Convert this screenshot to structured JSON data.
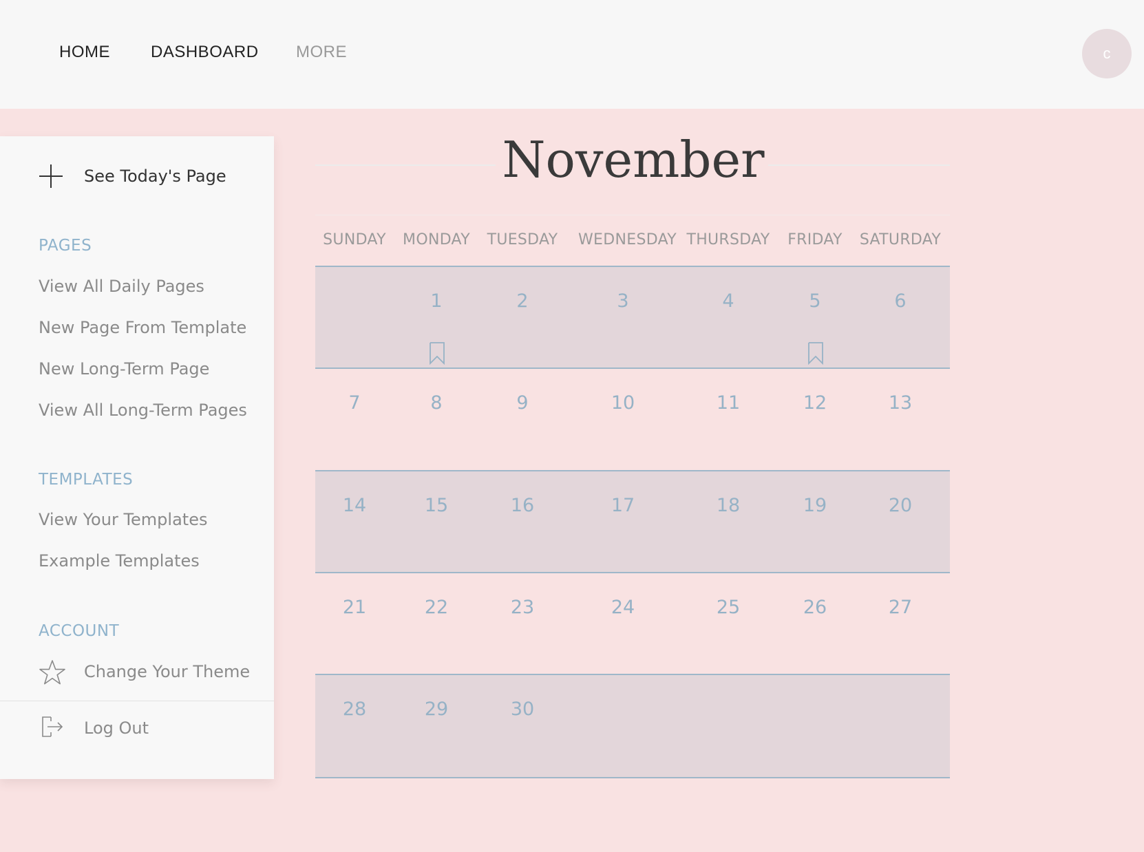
{
  "nav": {
    "home": "HOME",
    "dashboard": "DASHBOARD",
    "more": "MORE",
    "avatar_initial": "c"
  },
  "sidebar": {
    "today": "See Today's Page",
    "pages_heading": "PAGES",
    "pages": [
      "View All Daily Pages",
      "New Page From Template",
      "New Long-Term Page",
      "View All Long-Term Pages"
    ],
    "templates_heading": "TEMPLATES",
    "templates": [
      "View Your Templates",
      "Example Templates"
    ],
    "account_heading": "ACCOUNT",
    "theme": "Change Your Theme",
    "logout": "Log Out"
  },
  "calendar": {
    "month": "November",
    "weekdays": [
      "SUNDAY",
      "MONDAY",
      "TUESDAY",
      "WEDNESDAY",
      "THURSDAY",
      "FRIDAY",
      "SATURDAY"
    ],
    "weeks": [
      [
        "",
        "1",
        "2",
        "3",
        "4",
        "5",
        "6"
      ],
      [
        "7",
        "8",
        "9",
        "10",
        "11",
        "12",
        "13"
      ],
      [
        "14",
        "15",
        "16",
        "17",
        "18",
        "19",
        "20"
      ],
      [
        "21",
        "22",
        "23",
        "24",
        "25",
        "26",
        "27"
      ],
      [
        "28",
        "29",
        "30",
        "",
        "",
        "",
        ""
      ]
    ],
    "bookmarked_days": [
      "1",
      "5"
    ]
  },
  "colors": {
    "background": "#f9e2e2",
    "shaded_week": "#e3d6da",
    "accent": "#96b2c6",
    "heading_blue": "#8fb3cc"
  },
  "icons": {
    "today": "plus-icon",
    "theme": "star-icon",
    "logout": "logout-icon",
    "bookmark": "bookmark-icon"
  }
}
